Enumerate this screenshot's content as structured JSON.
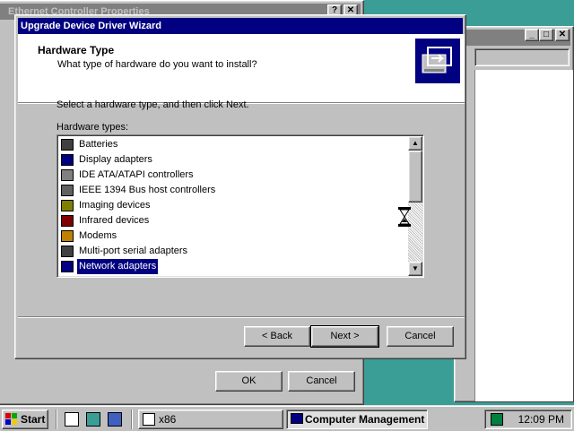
{
  "ethernet_window": {
    "title": "Ethernet Controller Properties",
    "ok_label": "OK",
    "cancel_label": "Cancel"
  },
  "cm_window": {
    "min": "_",
    "max": "□",
    "close": "✕"
  },
  "wizard": {
    "title": "Upgrade Device Driver Wizard",
    "header_title": "Hardware Type",
    "header_subtitle": "What type of hardware do you want to install?",
    "instruction": "Select a hardware type, and then click Next.",
    "list_label": "Hardware types:",
    "items": [
      {
        "label": "Batteries",
        "icon": "battery-icon",
        "selected": false
      },
      {
        "label": "Display adapters",
        "icon": "monitor-icon",
        "selected": false
      },
      {
        "label": "IDE ATA/ATAPI controllers",
        "icon": "drive-icon",
        "selected": false
      },
      {
        "label": "IEEE 1394 Bus host controllers",
        "icon": "bus-controller-icon",
        "selected": false
      },
      {
        "label": "Imaging devices",
        "icon": "camera-icon",
        "selected": false
      },
      {
        "label": "Infrared devices",
        "icon": "infrared-icon",
        "selected": false
      },
      {
        "label": "Modems",
        "icon": "modem-icon",
        "selected": false
      },
      {
        "label": "Multi-port serial adapters",
        "icon": "serial-port-icon",
        "selected": false
      },
      {
        "label": "Network adapters",
        "icon": "network-adapter-icon",
        "selected": true
      }
    ],
    "back_label": "< Back",
    "next_label": "Next >",
    "cancel_label": "Cancel",
    "help": "?",
    "close": "✕"
  },
  "taskbar": {
    "start_label": "Start",
    "task1_label": "x86",
    "task2_label": "Computer Management",
    "clock": "12:09 PM"
  },
  "colors": {
    "desktop": "#3a9e96",
    "titlebar_active": "#000080",
    "face": "#c0c0c0"
  }
}
